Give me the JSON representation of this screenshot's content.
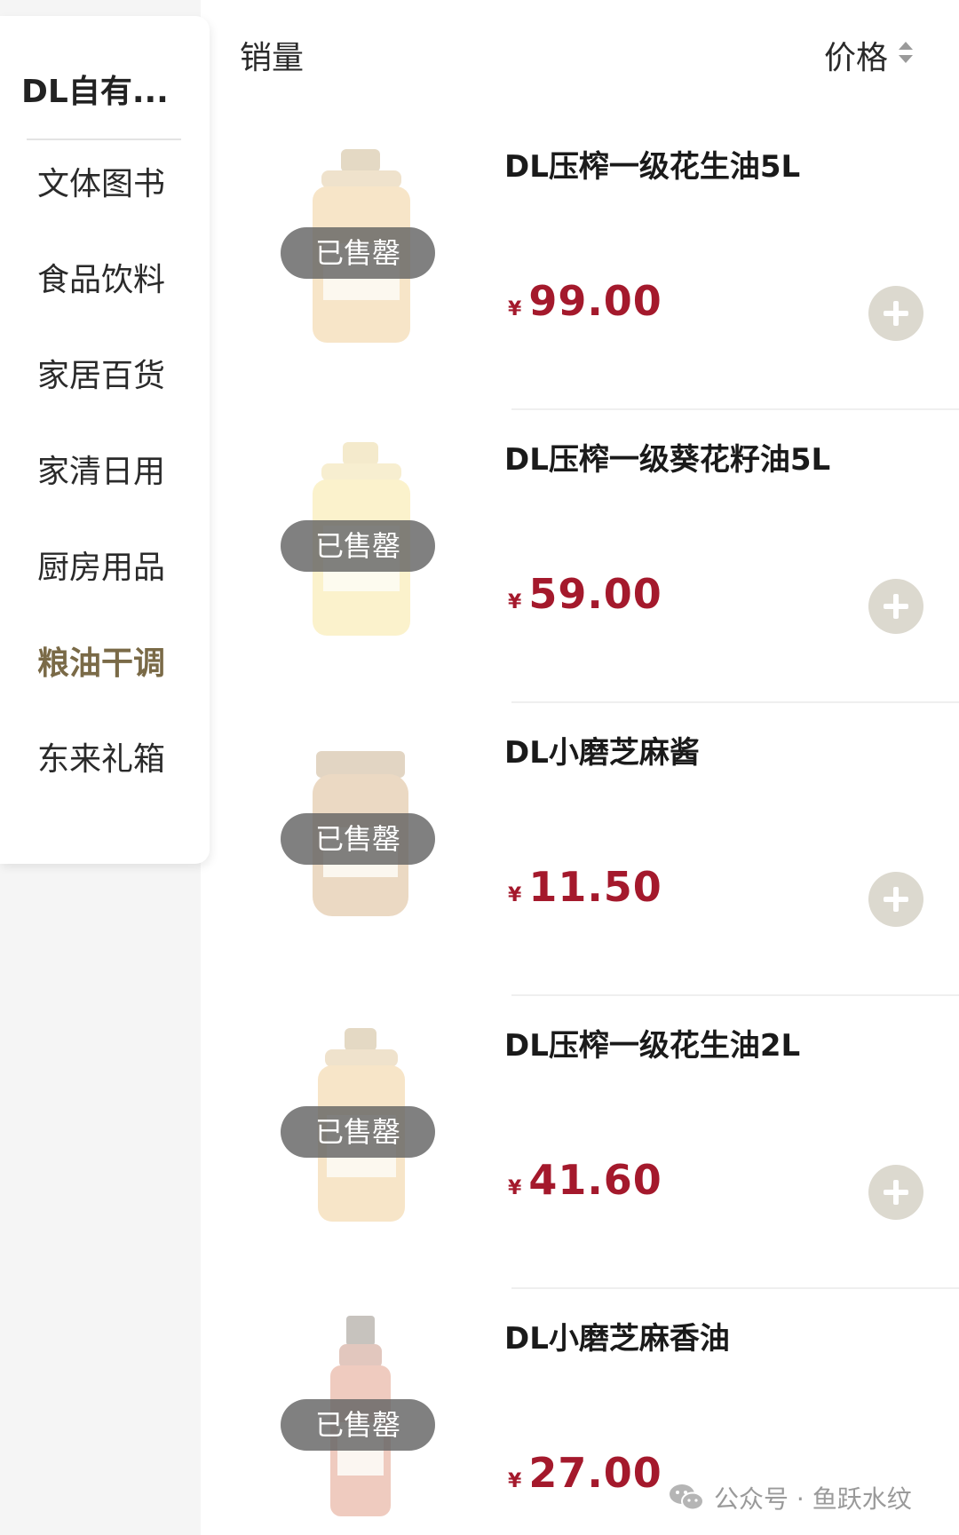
{
  "sidebar": {
    "brand": "DL自有...",
    "categories": [
      "文体图书",
      "食品饮料",
      "家居百货",
      "家清日用",
      "厨房用品",
      "粮油干调",
      "东来礼箱"
    ],
    "active_category": "粮油干调"
  },
  "sort": {
    "sales_label": "销量",
    "price_label": "价格"
  },
  "products": [
    {
      "name": "DL压榨一级花生油5L",
      "currency": "¥",
      "price": "99.00",
      "status": "已售罄"
    },
    {
      "name": "DL压榨一级葵花籽油5L",
      "currency": "¥",
      "price": "59.00",
      "status": "已售罄"
    },
    {
      "name": "DL小磨芝麻酱",
      "currency": "¥",
      "price": "11.50",
      "status": "已售罄"
    },
    {
      "name": "DL压榨一级花生油2L",
      "currency": "¥",
      "price": "41.60",
      "status": "已售罄"
    },
    {
      "name": "DL小磨芝麻香油",
      "currency": "¥",
      "price": "27.00",
      "status": "已售罄"
    }
  ],
  "watermark": {
    "text": "公众号 · 鱼跃水纹",
    "icon": "wechat-icon"
  },
  "colors": {
    "price": "#a4192c",
    "active_category": "#7a6a47",
    "soldout_badge": "#646464",
    "add_button": "#dcd9cf"
  }
}
